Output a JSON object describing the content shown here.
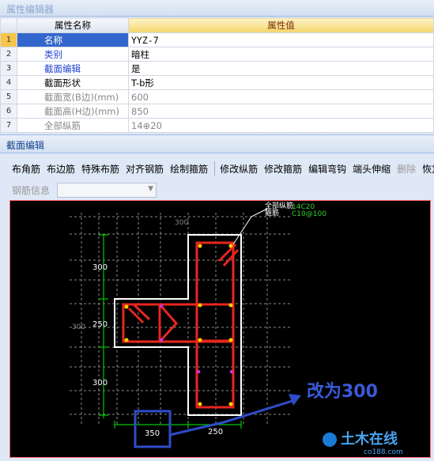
{
  "window": {
    "title": "属性编辑器"
  },
  "grid": {
    "headers": {
      "name": "属性名称",
      "value": "属性值"
    },
    "rows": [
      {
        "num": "1",
        "name": "名称",
        "value": "YYZ-7"
      },
      {
        "num": "2",
        "name": "类别",
        "value": "暗柱"
      },
      {
        "num": "3",
        "name": "截面编辑",
        "value": "是"
      },
      {
        "num": "4",
        "name": "截面形状",
        "value": "T-b形"
      },
      {
        "num": "5",
        "name": "截面宽(B边)(mm)",
        "value": "600"
      },
      {
        "num": "6",
        "name": "截面高(H边)(mm)",
        "value": "850"
      },
      {
        "num": "7",
        "name": "全部纵筋",
        "value": "14⊕20"
      }
    ]
  },
  "section": {
    "title": "截面编辑"
  },
  "toolbar": {
    "buttons": [
      "布角筋",
      "布边筋",
      "特殊布筋",
      "对齐钢筋",
      "绘制箍筋",
      "修改纵筋",
      "修改箍筋",
      "编辑弯钩",
      "端头伸缩",
      "删除",
      "恢复"
    ],
    "rebar_info_label": "钢筋信息"
  },
  "canvas": {
    "grid_label_top": "300",
    "grid_label_left": "300",
    "callout_line1": "全部纵筋",
    "callout_line2": "箍筋",
    "callout_value1": "14C20",
    "callout_value2": "C10@100",
    "dim_top": "300",
    "dim_mid": "250",
    "dim_bottom": "300",
    "dim_bottom_left": "350",
    "dim_bottom_right": "250",
    "annotation": "改为300",
    "watermark_cn": "土木在线",
    "watermark_en": "co188.com"
  },
  "colors": {
    "accent": "#3366cc",
    "annotation": "#2f4cc8",
    "rebar": "#e8261e",
    "dim": "#00c800"
  }
}
